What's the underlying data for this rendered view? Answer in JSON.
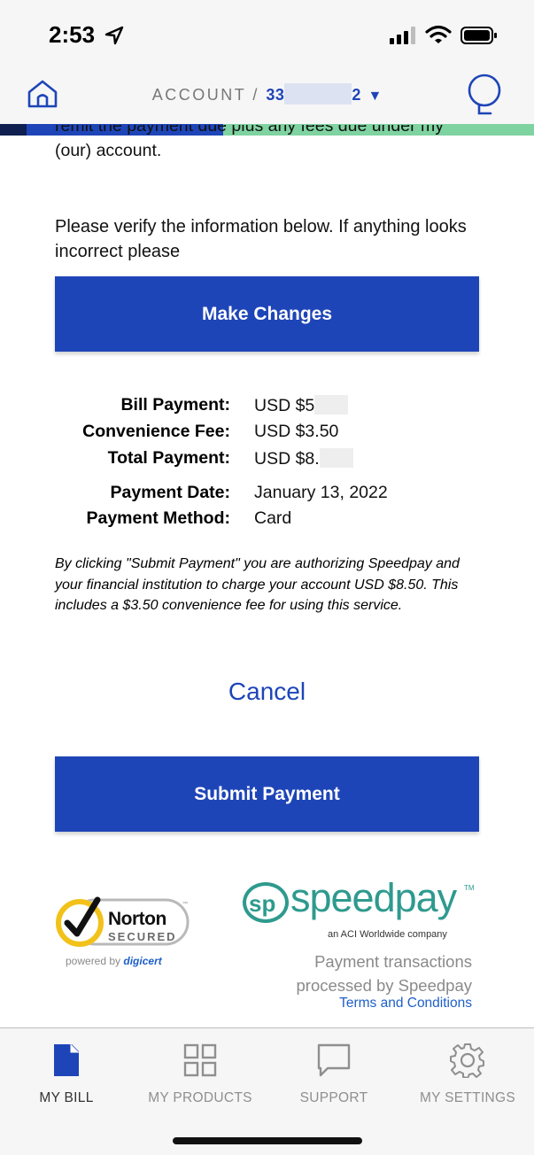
{
  "status_bar": {
    "time": "2:53",
    "icons": [
      "location-arrow-icon",
      "cellular-signal-icon",
      "wifi-icon",
      "battery-icon"
    ]
  },
  "header": {
    "account_prefix": "ACCOUNT /",
    "account_start": "33",
    "account_end": "2",
    "account_caret": "▼",
    "home_icon": "home-icon",
    "chat_icon": "chat-bubble-icon"
  },
  "progress_colors": [
    "#0f1f4f",
    "#1e45b8",
    "#7fd3a0"
  ],
  "content": {
    "partial_text_line1": "remit the payment due plus any fees due under my",
    "partial_text_line2": "(our) account.",
    "verify_text": "Please verify the information below. If anything looks incorrect please",
    "make_changes_label": "Make Changes",
    "summary": {
      "bill_payment_label": "Bill Payment:",
      "bill_payment_value": "USD $5",
      "convenience_fee_label": "Convenience Fee:",
      "convenience_fee_value": "USD $3.50",
      "total_payment_label": "Total Payment:",
      "total_payment_value": "USD $8.",
      "payment_date_label": "Payment Date:",
      "payment_date_value": "January 13, 2022",
      "payment_method_label": "Payment Method:",
      "payment_method_value": "Card"
    },
    "disclaimer": "By clicking \"Submit Payment\" you are authorizing Speedpay and your financial institution to charge your account USD $8.50. This includes a $3.50 convenience fee for using this service.",
    "cancel_label": "Cancel",
    "submit_label": "Submit Payment"
  },
  "trust": {
    "norton_name": "Norton",
    "norton_secured": "SECURED",
    "norton_tm": "™",
    "powered_by": "powered by",
    "digicert": "digicert",
    "speedpay_word": "speedpay",
    "speedpay_tm": "TM",
    "speedpay_sub": "an ACI Worldwide company",
    "processed_line1": "Payment transactions",
    "processed_line2": "processed by Speedpay",
    "terms_label": "Terms and Conditions"
  },
  "bottom_nav": {
    "items": [
      {
        "label": "MY BILL",
        "icon": "document-icon",
        "active": true
      },
      {
        "label": "MY PRODUCTS",
        "icon": "grid-icon",
        "active": false
      },
      {
        "label": "SUPPORT",
        "icon": "speech-bubble-icon",
        "active": false
      },
      {
        "label": "MY SETTINGS",
        "icon": "gear-icon",
        "active": false
      }
    ]
  },
  "colors": {
    "brand_blue": "#1e45b8",
    "speedpay_teal": "#2e9a8e",
    "link_blue": "#1e5fc8"
  }
}
